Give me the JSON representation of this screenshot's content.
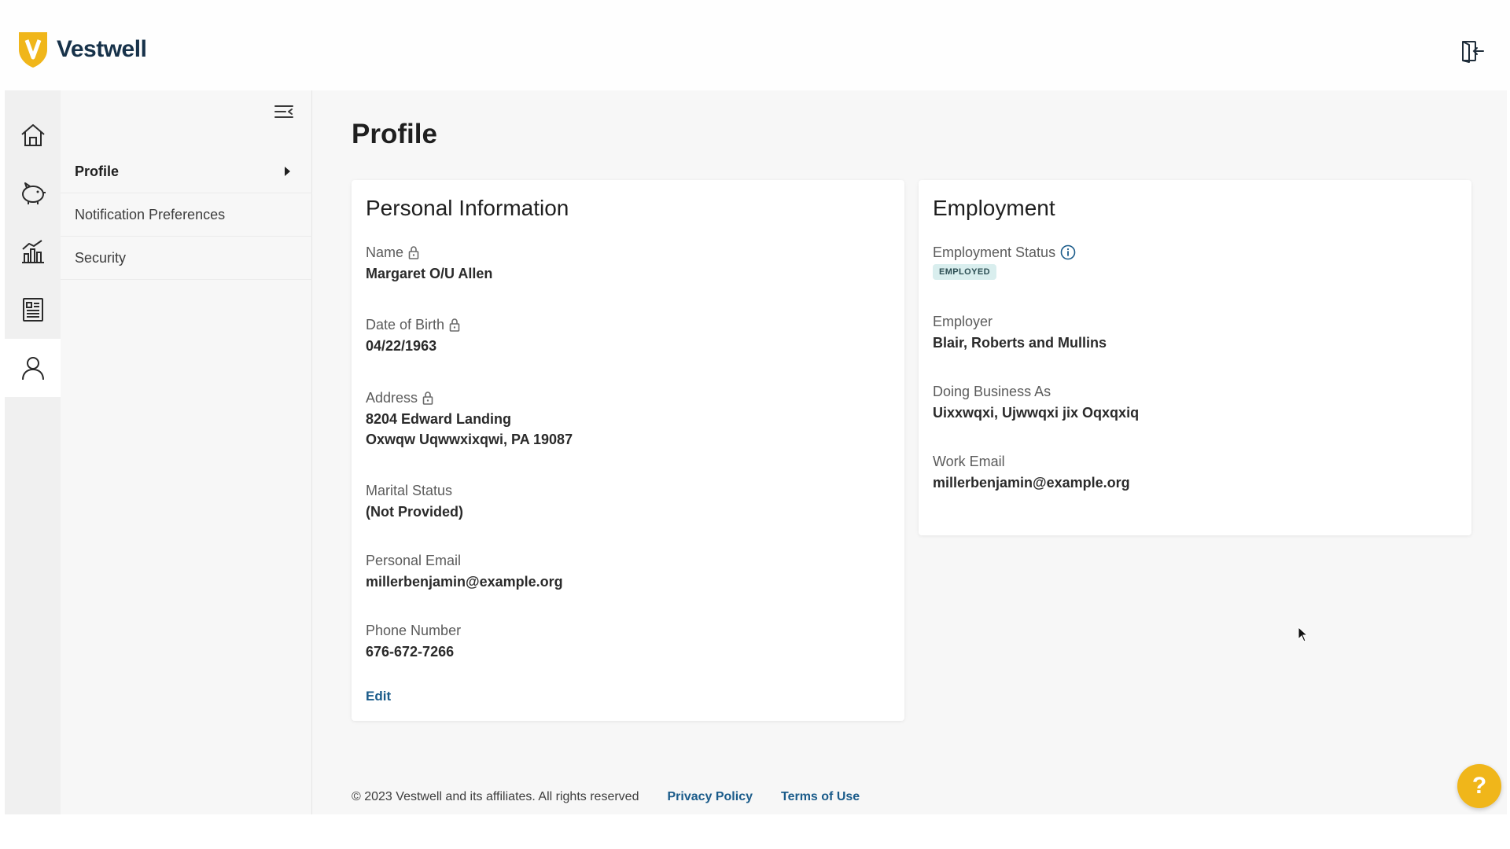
{
  "brand": {
    "name": "Vestwell",
    "accent": "#f0b61a",
    "letter": "V"
  },
  "header": {
    "logout_icon": "logout-icon"
  },
  "rail": {
    "items": [
      {
        "icon": "home-icon"
      },
      {
        "icon": "piggy-bank-icon"
      },
      {
        "icon": "bar-chart-icon"
      },
      {
        "icon": "document-icon"
      },
      {
        "icon": "user-icon",
        "active": true
      }
    ]
  },
  "subnav": {
    "collapse_icon": "collapse-menu-icon",
    "items": [
      {
        "label": "Profile",
        "active": true
      },
      {
        "label": "Notification Preferences"
      },
      {
        "label": "Security"
      }
    ]
  },
  "page": {
    "title": "Profile"
  },
  "personal": {
    "title": "Personal Information",
    "name_label": "Name",
    "name_value": "Margaret O/U Allen",
    "dob_label": "Date of Birth",
    "dob_value": "04/22/1963",
    "address_label": "Address",
    "address_line1": "8204 Edward Landing",
    "address_line2": "Oxwqw Uqwwxixqwi, PA 19087",
    "marital_label": "Marital Status",
    "marital_value": "(Not Provided)",
    "email_label": "Personal Email",
    "email_value": "millerbenjamin@example.org",
    "phone_label": "Phone Number",
    "phone_value": "676-672-7266",
    "edit_label": "Edit"
  },
  "employment": {
    "title": "Employment",
    "status_label": "Employment Status",
    "status_badge": "EMPLOYED",
    "employer_label": "Employer",
    "employer_value": "Blair, Roberts and Mullins",
    "dba_label": "Doing Business As",
    "dba_value": "Uixxwqxi, Ujwwqxi jix Oqxqxiq",
    "work_email_label": "Work Email",
    "work_email_value": "millerbenjamin@example.org"
  },
  "footer": {
    "copyright": "© 2023 Vestwell and its affiliates. All rights reserved",
    "privacy": "Privacy Policy",
    "terms": "Terms of Use"
  },
  "help": {
    "label": "?"
  }
}
